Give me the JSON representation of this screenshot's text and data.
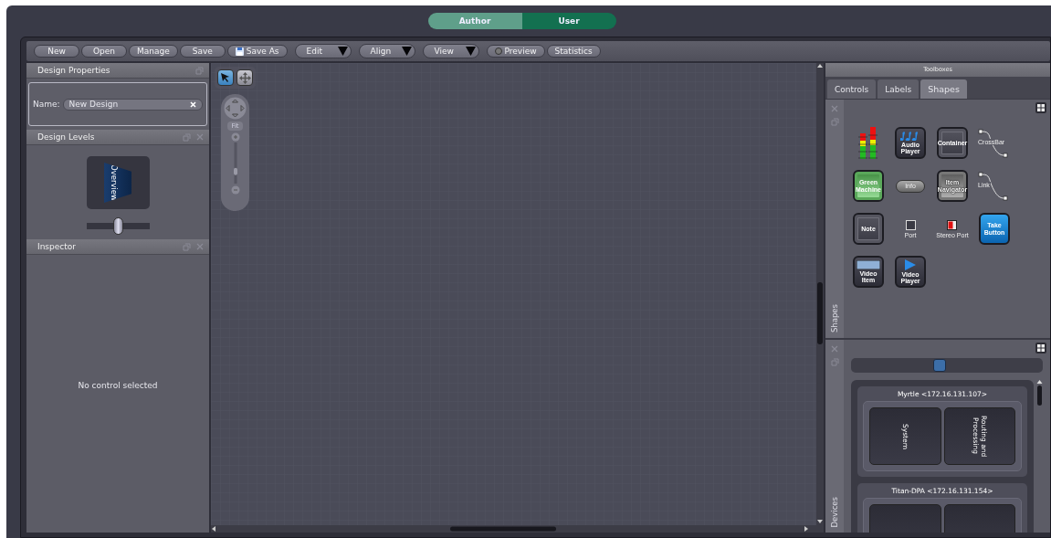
{
  "mode_switch": [
    {
      "label": "Author",
      "selected": true
    },
    {
      "label": "User",
      "selected": false
    }
  ],
  "toolbar": [
    {
      "kind": "button",
      "label": "New"
    },
    {
      "kind": "button",
      "label": "Open"
    },
    {
      "kind": "button",
      "label": "Manage"
    },
    {
      "kind": "button",
      "label": "Save"
    },
    {
      "kind": "save",
      "label": "Save As"
    },
    {
      "kind": "menu",
      "label": "Edit"
    },
    {
      "kind": "menu",
      "label": "Align"
    },
    {
      "kind": "menu",
      "label": "View"
    },
    {
      "kind": "radio",
      "label": "Preview"
    },
    {
      "kind": "button",
      "label": "Statistics"
    }
  ],
  "design_properties": {
    "title": "Design Properties",
    "name_label": "Name:",
    "name_value": "New Design"
  },
  "design_levels": {
    "title": "Design Levels",
    "level_label": "Overview",
    "slider": {
      "level": 0.5
    }
  },
  "inspector": {
    "title": "Inspector",
    "empty_message": "No control selected"
  },
  "canvas": {
    "tools": [
      {
        "kind": "select",
        "selected": true
      },
      {
        "kind": "pan",
        "selected": false
      }
    ],
    "fit_label": "Fit",
    "zoom": {
      "level": 0.25
    }
  },
  "toolboxes": {
    "title": "Toolboxes",
    "side_label": "Shapes",
    "tabs": [
      {
        "label": "Controls",
        "selected": false
      },
      {
        "label": "Labels",
        "selected": false
      },
      {
        "label": "Shapes",
        "selected": true
      }
    ],
    "items": [
      {
        "kind": "meter"
      },
      {
        "kind": "audio-tile",
        "label": "Audio Player"
      },
      {
        "kind": "container-tile",
        "label": "Container"
      },
      {
        "kind": "connector",
        "label": "CrossBar"
      },
      {
        "kind": "green-tile",
        "label": "Green Machine"
      },
      {
        "kind": "pill",
        "label": "Info"
      },
      {
        "kind": "navigator-tile",
        "label": "Item Navigator"
      },
      {
        "kind": "connector",
        "label": "Link"
      },
      {
        "kind": "note-tile",
        "label": "Note"
      },
      {
        "kind": "port",
        "label": "Port"
      },
      {
        "kind": "stereo",
        "label": "Stereo Port"
      },
      {
        "kind": "take-tile",
        "label": "Take Button"
      },
      {
        "kind": "video-tile",
        "label": "Video Item"
      },
      {
        "kind": "player-tile",
        "label": "Video Player"
      }
    ]
  },
  "devices": {
    "side_label": "Devices",
    "slider": {
      "level": 0.46
    },
    "devices": [
      {
        "name": "Myrtle <172.16.131.107>",
        "blocks": [
          {
            "kind": "block",
            "label": "System"
          },
          {
            "kind": "block",
            "label": "Routing and Processing"
          }
        ]
      },
      {
        "name": "Titan-DPA <172.16.131.154>",
        "blocks": [
          {
            "kind": "block"
          },
          {
            "kind": "block"
          }
        ]
      }
    ]
  }
}
